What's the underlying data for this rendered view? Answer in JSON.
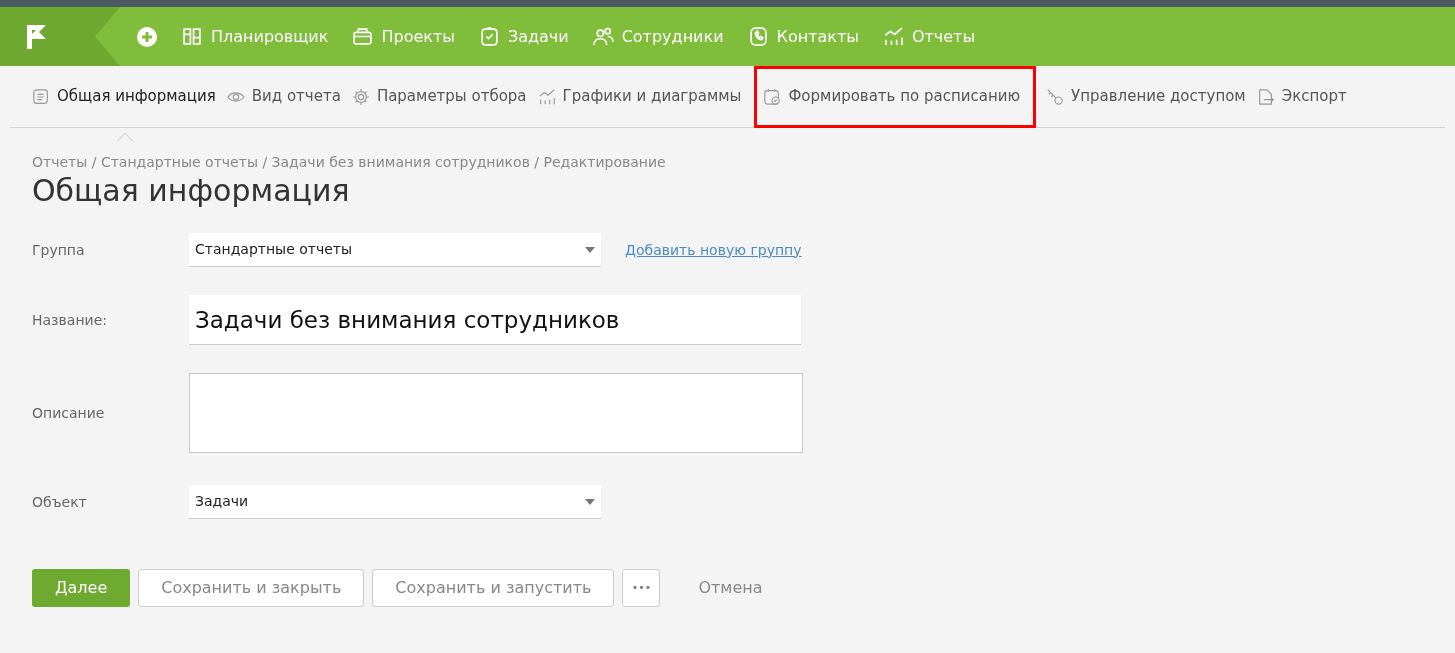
{
  "top_nav": {
    "items": [
      {
        "kind": "planner",
        "label": "Планировщик"
      },
      {
        "kind": "projects",
        "label": "Проекты"
      },
      {
        "kind": "tasks",
        "label": "Задачи"
      },
      {
        "kind": "people",
        "label": "Сотрудники"
      },
      {
        "kind": "contacts",
        "label": "Контакты"
      },
      {
        "kind": "reports",
        "label": "Отчеты"
      }
    ]
  },
  "tabs": [
    {
      "kind": "info",
      "label": "Общая информация",
      "selected": true,
      "highlighted": false
    },
    {
      "kind": "view",
      "label": "Вид отчета",
      "selected": false,
      "highlighted": false
    },
    {
      "kind": "filter",
      "label": "Параметры отбора",
      "selected": false,
      "highlighted": false
    },
    {
      "kind": "charts",
      "label": "Графики и диаграммы",
      "selected": false,
      "highlighted": false
    },
    {
      "kind": "schedule",
      "label": "Формировать по расписанию",
      "selected": false,
      "highlighted": true
    },
    {
      "kind": "access",
      "label": "Управление доступом",
      "selected": false,
      "highlighted": false
    },
    {
      "kind": "export",
      "label": "Экспорт",
      "selected": false,
      "highlighted": false
    }
  ],
  "breadcrumb": "Отчеты / Стандартные отчеты / Задачи без внимания сотрудников / Редактирование",
  "heading": "Общая информация",
  "form": {
    "group": {
      "label": "Группа",
      "value": "Стандартные отчеты",
      "link": "Добавить новую группу"
    },
    "name": {
      "label": "Название:",
      "value": "Задачи без внимания сотрудников"
    },
    "description": {
      "label": "Описание"
    },
    "object": {
      "label": "Объект",
      "value": "Задачи"
    }
  },
  "buttons": [
    {
      "kind": "primary",
      "label": "Далее"
    },
    {
      "kind": "outline",
      "label": "Сохранить и закрыть"
    },
    {
      "kind": "outline",
      "label": "Сохранить и запустить"
    },
    {
      "kind": "more",
      "label": "•••"
    },
    {
      "kind": "link",
      "label": "Отмена"
    }
  ]
}
